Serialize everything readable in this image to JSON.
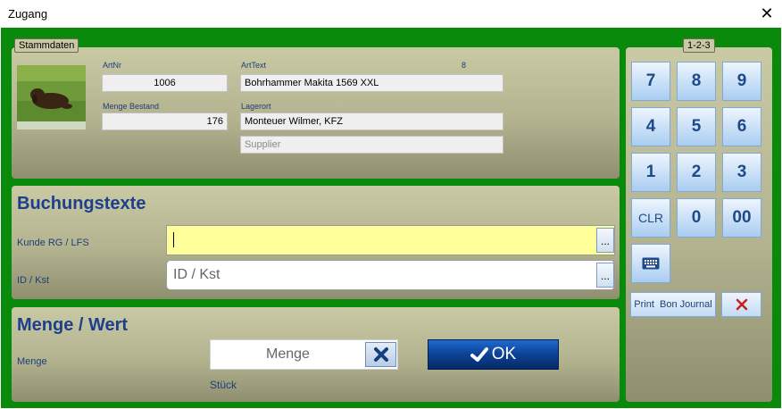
{
  "window": {
    "title": "Zugang",
    "close": "✕"
  },
  "stammdaten": {
    "legend": "Stammdaten",
    "artnr_label": "ArtNr",
    "artnr_value": "1006",
    "arttext_label": "ArtText",
    "arttext_count": "8",
    "arttext_value": "Bohrhammer Makita 1569 XXL",
    "menge_bestand_label": "Menge Bestand",
    "menge_bestand_value": "176",
    "lagerort_label": "Lagerort",
    "lagerort_value": "Monteuer Wilmer, KFZ",
    "supplier_placeholder": "Supplier"
  },
  "buchungstexte": {
    "title": "Buchungstexte",
    "kunde_label": "Kunde RG / LFS",
    "kunde_value": "",
    "kunde_browse": "...",
    "id_label": "ID / Kst",
    "id_placeholder": "ID / Kst",
    "id_browse": "..."
  },
  "menge_wert": {
    "title": "Menge / Wert",
    "menge_label": "Menge",
    "menge_placeholder": "Menge",
    "unit": "Stück",
    "ok_label": "OK"
  },
  "keypad": {
    "legend": "1-2-3",
    "keys": [
      "7",
      "8",
      "9",
      "4",
      "5",
      "6",
      "1",
      "2",
      "3",
      "CLR",
      "0",
      "00"
    ],
    "print_label": "Print  Bon Journal"
  },
  "colors": {
    "background": "#0a8a0a",
    "input_active": "#ffff99",
    "heading": "#1d3f8c",
    "ok_button": "#0b3f8a"
  }
}
